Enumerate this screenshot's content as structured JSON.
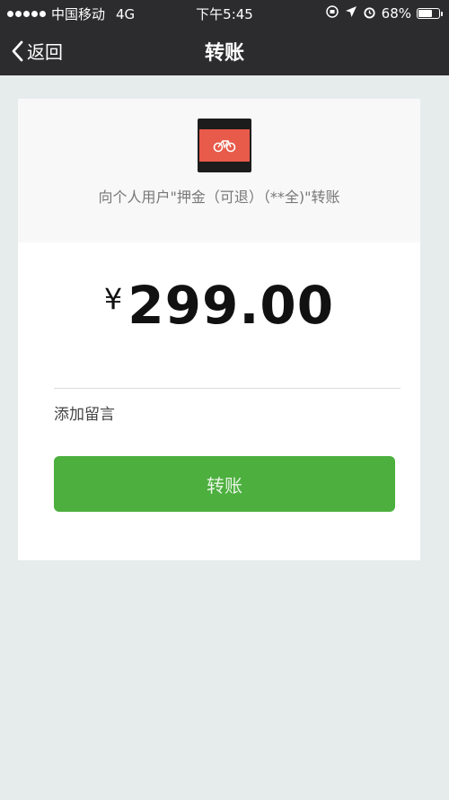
{
  "status_bar": {
    "carrier": "中国移动",
    "network": "4G",
    "time": "下午5:45",
    "battery_text": "68%",
    "battery_level": 0.68
  },
  "nav": {
    "back_label": "返回",
    "title": "转账"
  },
  "payee": {
    "label": "向个人用户\"押金（可退）（**全)\"转账"
  },
  "amount": {
    "currency": "¥",
    "value": "299.00"
  },
  "remark": {
    "label": "添加留言"
  },
  "actions": {
    "transfer_label": "转账"
  },
  "colors": {
    "nav_background": "#2c2c2e",
    "primary_button": "#4caf3e",
    "avatar_accent": "#e85a4a"
  }
}
